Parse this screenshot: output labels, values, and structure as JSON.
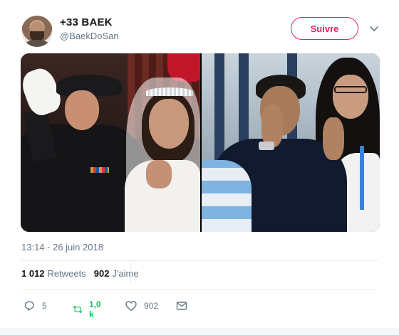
{
  "author": {
    "display_name": "+33 BAEK",
    "handle": "@BaekDoSan",
    "avatar_icon": "avatar-photo"
  },
  "follow_button": {
    "label": "Suivre"
  },
  "menu_icon": "chevron-down-icon",
  "media": {
    "images": [
      "royal-wedding-photo",
      "stadium-fan-photo"
    ]
  },
  "timestamp": "13:14 - 26 juin 2018",
  "stats": {
    "retweets_count": "1 012",
    "retweets_label": "Retweets",
    "likes_count": "902",
    "likes_label": "J'aime"
  },
  "actions": {
    "reply_count": "5",
    "retweet_count": "1,0 k",
    "like_count": "902"
  },
  "colors": {
    "accent_pink": "#e0245e",
    "retweet_green": "#17bf63",
    "secondary_text": "#657786",
    "primary_text": "#14171a"
  }
}
